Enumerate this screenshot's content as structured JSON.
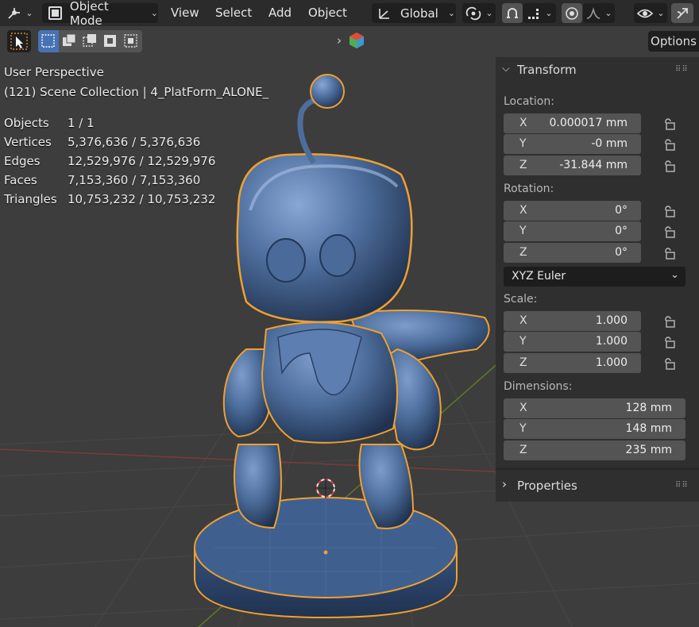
{
  "header": {
    "mode": "Object Mode",
    "menus": [
      "View",
      "Select",
      "Add",
      "Object"
    ],
    "orientation": "Global"
  },
  "options_label": "Options",
  "overlay": {
    "perspective": "User Perspective",
    "collection": "(121) Scene Collection | 4_PlatForm_ALONE_",
    "stats": [
      {
        "label": "Objects",
        "value": "1 / 1"
      },
      {
        "label": "Vertices",
        "value": "5,376,636 / 5,376,636"
      },
      {
        "label": "Edges",
        "value": "12,529,976 / 12,529,976"
      },
      {
        "label": "Faces",
        "value": "7,153,360 / 7,153,360"
      },
      {
        "label": "Triangles",
        "value": "10,753,232 / 10,753,232"
      }
    ]
  },
  "panel": {
    "transform_title": "Transform",
    "location_label": "Location:",
    "location": [
      {
        "axis": "X",
        "value": "0.000017 mm"
      },
      {
        "axis": "Y",
        "value": "-0 mm"
      },
      {
        "axis": "Z",
        "value": "-31.844 mm"
      }
    ],
    "rotation_label": "Rotation:",
    "rotation": [
      {
        "axis": "X",
        "value": "0°"
      },
      {
        "axis": "Y",
        "value": "0°"
      },
      {
        "axis": "Z",
        "value": "0°"
      }
    ],
    "rotation_mode": "XYZ Euler",
    "scale_label": "Scale:",
    "scale": [
      {
        "axis": "X",
        "value": "1.000"
      },
      {
        "axis": "Y",
        "value": "1.000"
      },
      {
        "axis": "Z",
        "value": "1.000"
      }
    ],
    "dimensions_label": "Dimensions:",
    "dimensions": [
      {
        "axis": "X",
        "value": "128 mm"
      },
      {
        "axis": "Y",
        "value": "148 mm"
      },
      {
        "axis": "Z",
        "value": "235 mm"
      }
    ],
    "properties_title": "Properties"
  },
  "colors": {
    "accent": "#4772b3",
    "model": "#4d6e9c",
    "outline": "#f0a030",
    "panel": "#2f2f2f"
  },
  "icons": [
    "editor-type-icon",
    "object-mode-icon",
    "select-cursor-icon",
    "select-box-icon",
    "transform-orientation-icon",
    "snap-icon",
    "proportional-icon",
    "visibility-icon",
    "gizmo-icon",
    "lock-icon"
  ]
}
